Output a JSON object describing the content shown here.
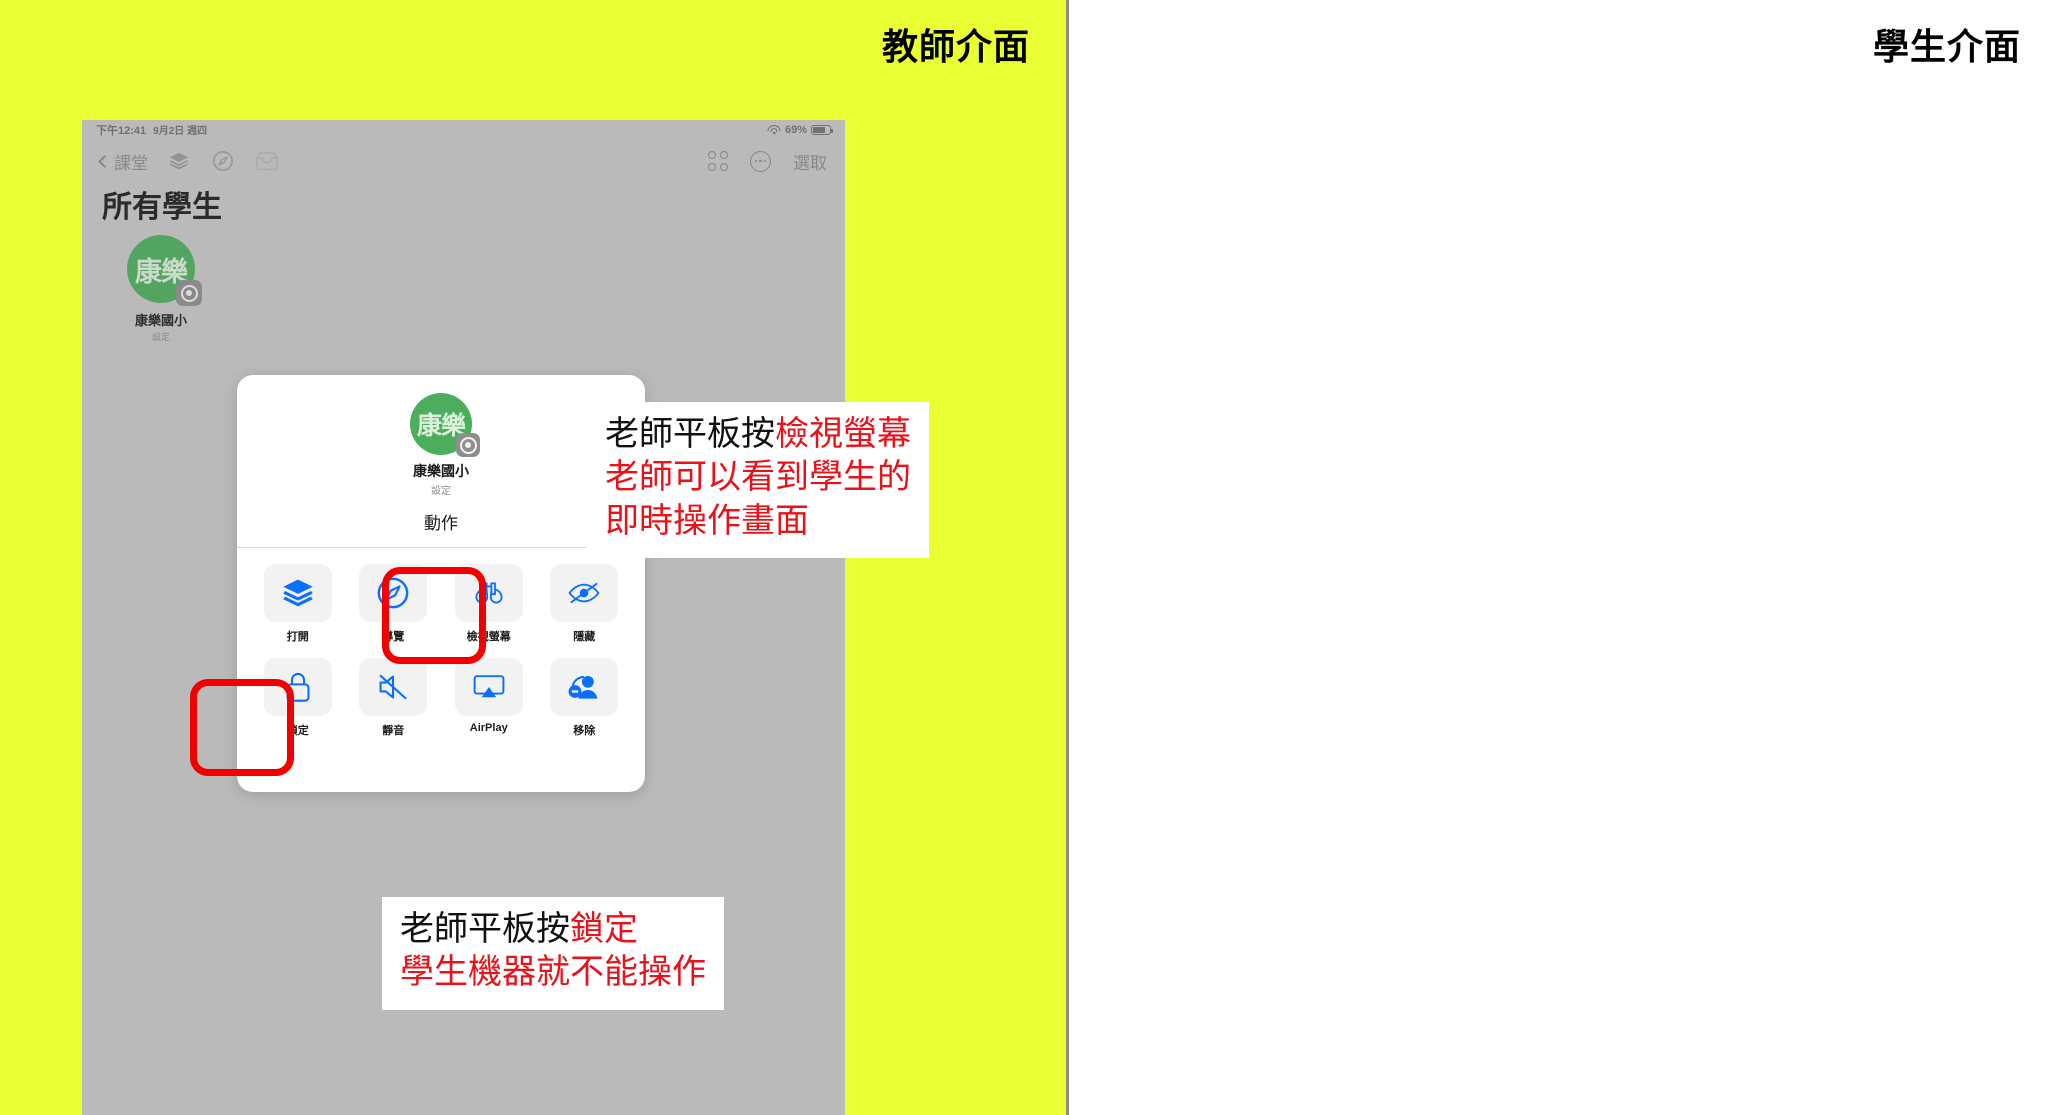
{
  "panels": {
    "teacher_title": "教師介面",
    "student_title": "學生介面",
    "teacher_bg": "#eaff33",
    "student_bg": "#ffffff"
  },
  "tablet": {
    "status_bar": {
      "time": "下午12:41",
      "date": "9月2日 週四",
      "battery_percent": "69%",
      "wifi_icon": "wifi-icon",
      "battery_icon": "battery-icon"
    },
    "toolbar": {
      "back_label": "課堂",
      "back_icon": "chevron-left-icon",
      "icons": [
        "layers-icon",
        "compass-icon",
        "inbox-icon"
      ],
      "grid_icon": "grid-view-icon",
      "more_icon": "more-ellipsis-icon",
      "select_label": "選取"
    },
    "page_heading": "所有學生",
    "student_tile": {
      "avatar_text": "康樂",
      "avatar_color": "#4cae5c",
      "badge_icon": "settings-gear-icon",
      "name": "康樂國小",
      "sub": "設定"
    }
  },
  "modal": {
    "avatar_text": "康樂",
    "name": "康樂國小",
    "sub": "設定",
    "section_title": "動作",
    "actions": [
      {
        "label": "打開",
        "icon": "layers-icon",
        "highlighted": false
      },
      {
        "label": "導覽",
        "icon": "compass-icon",
        "highlighted": false
      },
      {
        "label": "檢視螢幕",
        "icon": "binoculars-icon",
        "highlighted": true
      },
      {
        "label": "隱藏",
        "icon": "eye-slash-icon",
        "highlighted": false
      },
      {
        "label": "鎖定",
        "icon": "lock-icon",
        "highlighted": true
      },
      {
        "label": "靜音",
        "icon": "speaker-mute-icon",
        "highlighted": false
      },
      {
        "label": "AirPlay",
        "icon": "airplay-icon",
        "highlighted": false
      },
      {
        "label": "移除",
        "icon": "person-minus-icon",
        "highlighted": false
      }
    ],
    "highlight_color": "#f20000",
    "icon_color": "#0a84ff"
  },
  "callouts": {
    "view_screen": {
      "line1_black": "老師平板按",
      "line1_red": "檢視螢幕",
      "line2_red": "老師可以看到學生的",
      "line3_red": "即時操作畫面"
    },
    "lock": {
      "line1_black": "老師平板按",
      "line1_red": "鎖定",
      "line2_red": "學生機器就不能操作"
    },
    "red_color": "#e8131a"
  }
}
